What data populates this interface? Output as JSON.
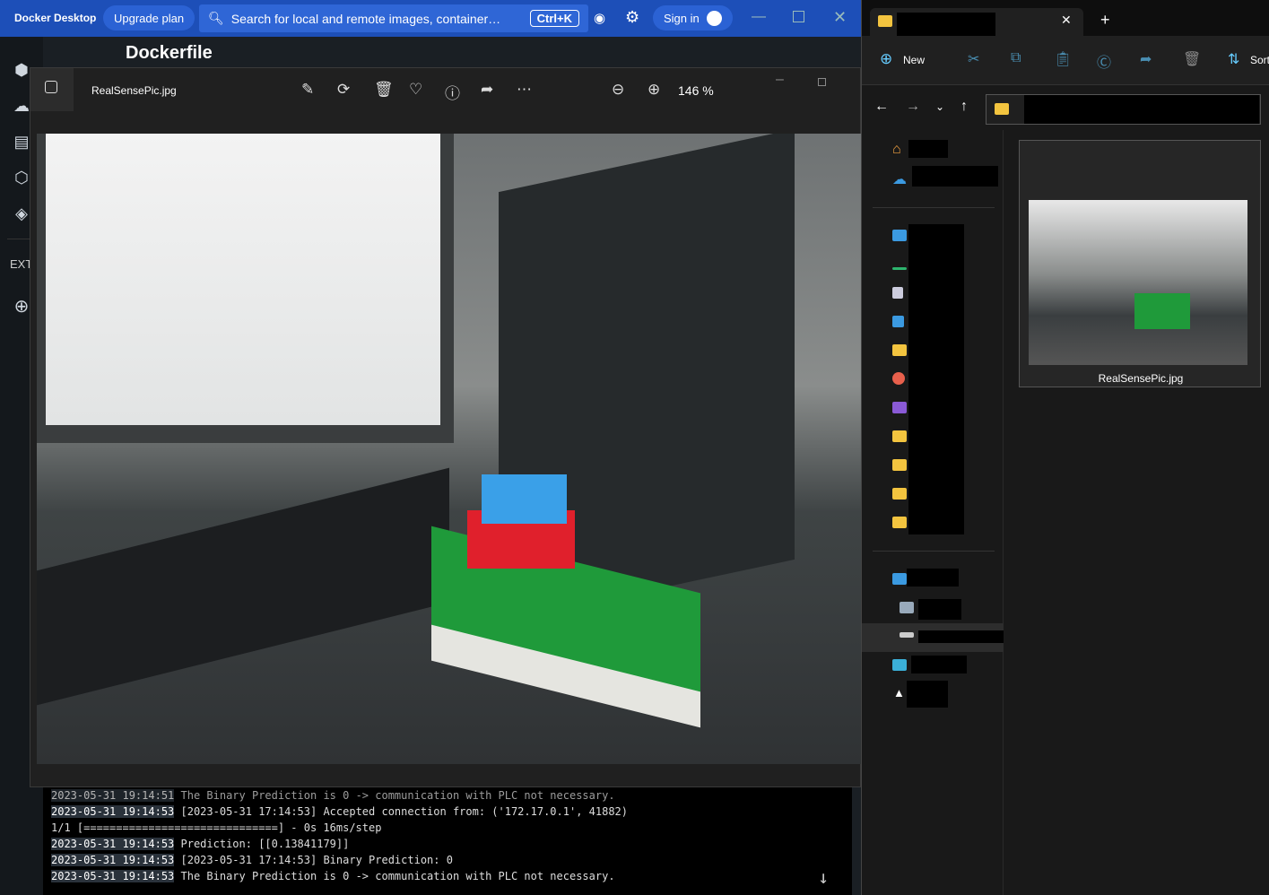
{
  "docker": {
    "app_name": "Docker Desktop",
    "upgrade": "Upgrade plan",
    "search_placeholder": "Search for local and remote images, container…",
    "shortcut": "Ctrl+K",
    "sign_in": "Sign in",
    "page_title": "Dockerfile",
    "ext_label": "EXT"
  },
  "photos": {
    "filename": "RealSensePic.jpg",
    "zoom": "146 %"
  },
  "log": [
    {
      "ts": "2023-05-31 19:14:51",
      "msg": " The Binary Prediction is 0 -> communication with PLC not necessary."
    },
    {
      "ts": "2023-05-31 19:14:53",
      "msg": " [2023-05-31 17:14:53] Accepted connection from: ('172.17.0.1', 41882)"
    },
    {
      "ts": "",
      "msg": "1/1 [==============================] - 0s 16ms/step"
    },
    {
      "ts": "2023-05-31 19:14:53",
      "msg": " Prediction: [[0.13841179]]"
    },
    {
      "ts": "2023-05-31 19:14:53",
      "msg": " [2023-05-31 17:14:53] Binary Prediction: 0"
    },
    {
      "ts": "2023-05-31 19:14:53",
      "msg": " The Binary Prediction is 0 -> communication with PLC not necessary."
    }
  ],
  "explorer": {
    "new_label": "New",
    "sort_label": "Sort",
    "file_name": "RealSensePic.jpg"
  }
}
